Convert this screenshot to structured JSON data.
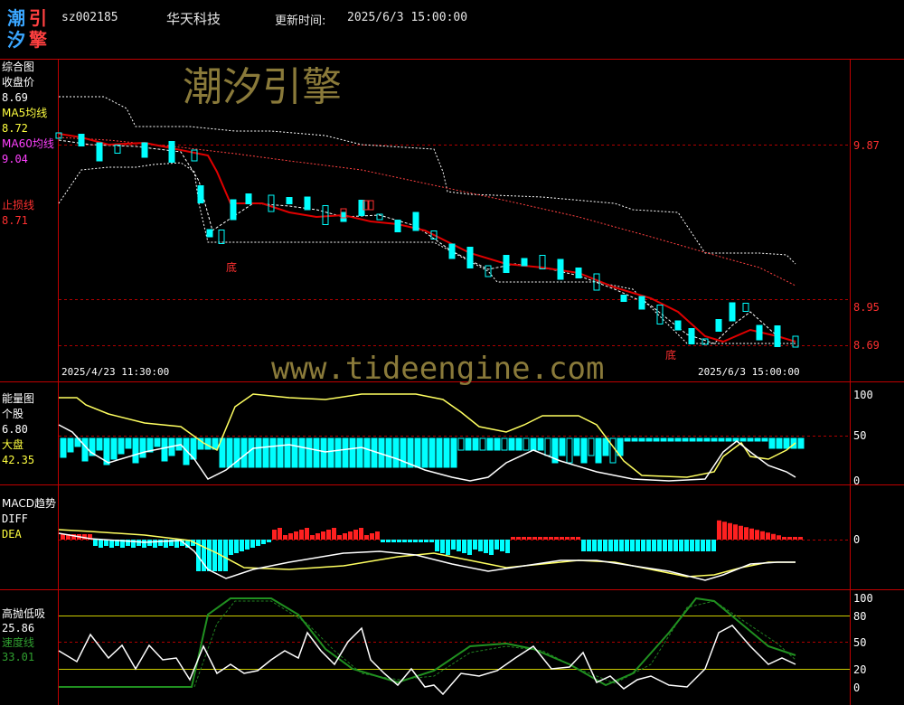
{
  "logo": {
    "chars": [
      "潮",
      "引",
      "汐",
      "擎"
    ]
  },
  "header": {
    "code": "sz002185",
    "name": "华天科技",
    "update_label": "更新时间:",
    "update_time": "2025/6/3 15:00:00"
  },
  "watermark": {
    "brand": "潮汐引擎",
    "url": "www.tideengine.com"
  },
  "panel1": {
    "title": "综合图",
    "close_label": "收盘价",
    "close_value": "8.69",
    "ma5_label": "MA5均线",
    "ma5_value": "8.72",
    "ma60_label": "MA60均线",
    "ma60_value": "9.04",
    "stop_label": "止损线",
    "stop_value": "8.71",
    "axis": [
      "9.87",
      "8.95",
      "8.69"
    ],
    "date_start": "2025/4/23 11:30:00",
    "date_end": "2025/6/3 15:00:00",
    "bottom_markers": [
      "底",
      "底"
    ],
    "colors": {
      "ma5": "#ffffff",
      "ma60": "#ff3333",
      "up": "#00ffff",
      "down": "#ff3333"
    }
  },
  "panel2": {
    "title": "能量图",
    "stock_label": "个股",
    "stock_value": "6.80",
    "market_label": "大盘",
    "market_value": "42.35",
    "axis": [
      "100",
      "50",
      "0"
    ]
  },
  "panel3": {
    "title": "MACD趋势",
    "diff_label": "DIFF",
    "dea_label": "DEA",
    "axis": [
      "0"
    ]
  },
  "panel4": {
    "title": "高抛低吸",
    "value1": "25.86",
    "speed_label": "速度线",
    "speed_value": "33.01",
    "axis": [
      "100",
      "80",
      "50",
      "20",
      "0"
    ]
  },
  "chart_data": [
    {
      "type": "candlestick",
      "title": "综合图",
      "x_range": [
        "2025/4/23 11:30:00",
        "2025/6/3 15:00:00"
      ],
      "series": [
        {
          "name": "MA60均线",
          "values": [
            9.57,
            9.55,
            9.52,
            9.47,
            9.43,
            9.38,
            9.33,
            9.29,
            9.24,
            9.21,
            9.17,
            9.13,
            9.09,
            9.06,
            9.04
          ]
        },
        {
          "name": "MA5均线",
          "values": [
            9.82,
            9.78,
            9.79,
            9.78,
            9.45,
            9.31,
            9.28,
            9.27,
            9.28,
            9.22,
            9.18,
            9.01,
            9.0,
            8.93,
            8.79,
            8.71,
            8.72
          ]
        },
        {
          "name": "收盘价",
          "values": [
            9.83,
            9.78,
            9.76,
            9.8,
            9.35,
            9.33,
            9.38,
            9.3,
            9.29,
            9.21,
            9.16,
            9.02,
            8.98,
            8.9,
            8.7,
            8.82,
            8.69
          ]
        }
      ],
      "reference_lines": [
        9.87,
        8.95,
        8.69
      ],
      "ylim": [
        8.5,
        10.1
      ]
    },
    {
      "type": "line",
      "title": "能量图",
      "ylim": [
        0,
        100
      ],
      "series": [
        {
          "name": "个股",
          "values": [
            58,
            30,
            35,
            18,
            12,
            30,
            28,
            32,
            25,
            20,
            15,
            5,
            10,
            38,
            22,
            2,
            5,
            22,
            10,
            6.8
          ]
        },
        {
          "name": "大盘",
          "values": [
            97,
            98,
            85,
            80,
            76,
            70,
            82,
            94,
            96,
            97,
            92,
            78,
            62,
            82,
            70,
            2,
            6,
            8,
            24,
            42.35
          ]
        }
      ],
      "reference_lines": [
        100,
        50,
        0
      ]
    },
    {
      "type": "bar",
      "title": "MACD趋势",
      "series": [
        {
          "name": "MACD",
          "values": [
            0.02,
            -0.01,
            -0.02,
            -0.03,
            -0.12,
            -0.1,
            0.02,
            0.03,
            0.01,
            -0.03,
            -0.06,
            -0.04,
            0.0,
            -0.05,
            0.09,
            0.03,
            0.01
          ]
        }
      ],
      "reference_lines": [
        0
      ]
    },
    {
      "type": "line",
      "title": "高抛低吸",
      "ylim": [
        0,
        100
      ],
      "series": [
        {
          "name": "高抛低吸",
          "values": [
            30,
            50,
            38,
            42,
            5,
            60,
            65,
            42,
            55,
            20,
            18,
            55,
            45,
            5,
            15,
            5,
            62,
            25,
            30,
            25.86
          ]
        },
        {
          "name": "速度线",
          "values": [
            5,
            5,
            5,
            5,
            5,
            80,
            99,
            90,
            70,
            10,
            5,
            30,
            50,
            38,
            8,
            55,
            99,
            75,
            45,
            33.01
          ]
        }
      ],
      "reference_lines": [
        100,
        80,
        50,
        20,
        0
      ]
    }
  ]
}
